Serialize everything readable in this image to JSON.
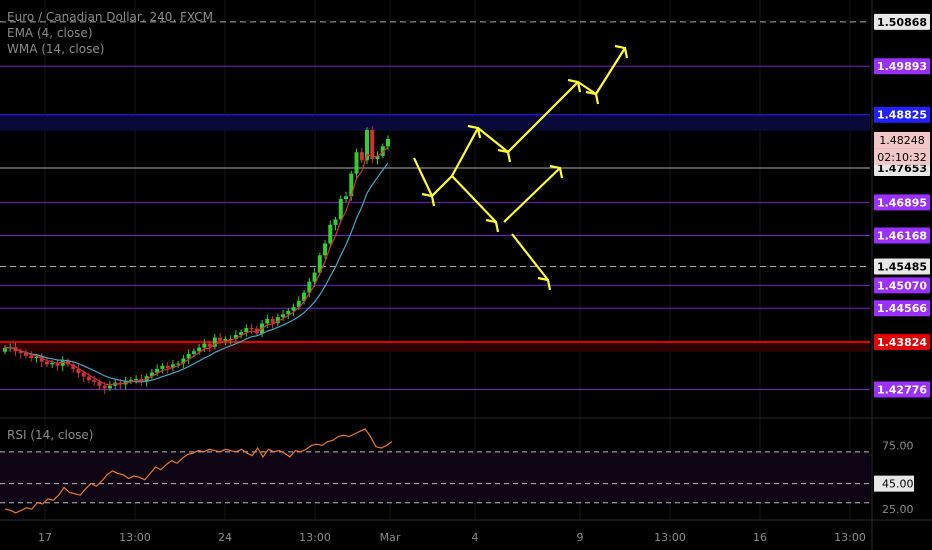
{
  "legend": {
    "title": "Euro / Canadian Dollar, 240, FXCM",
    "ema": "EMA (4, close)",
    "wma": "WMA (14, close)"
  },
  "rsi_legend": "RSI (14, close)",
  "colors": {
    "background": "#000000",
    "up_candle": "#33cc33",
    "down_candle": "#cc3333",
    "ema": "#cc3333",
    "wma": "#4aa3c8",
    "arrows": "#ffff33",
    "rsi": "#e8772e",
    "purple": "#9b30ff",
    "red": "#e00000",
    "blue": "#2222ff",
    "gray": "#aaaaaa"
  },
  "chart_data": [
    {
      "type": "candlestick",
      "title": "Euro / Canadian Dollar, 240, FXCM",
      "indicators": [
        "EMA (4, close)",
        "WMA (14, close)"
      ],
      "ylim": [
        1.4215,
        1.5135
      ],
      "x_tick_labels": [
        "17",
        "13:00",
        "24",
        "13:00",
        "Mar",
        "4",
        "9",
        "13:00",
        "16",
        "13:00"
      ],
      "price_levels": [
        {
          "value": 1.50868,
          "label": "1.50868",
          "color": "gray",
          "style": "dashed"
        },
        {
          "value": 1.49893,
          "label": "1.49893",
          "color": "purple",
          "style": "solid"
        },
        {
          "value": 1.48825,
          "label": "1.48825",
          "color": "blue",
          "style": "solid"
        },
        {
          "value": 1.47653,
          "label": "1.47653",
          "color": "gray",
          "style": "solid"
        },
        {
          "value": 1.46895,
          "label": "1.46895",
          "color": "purple",
          "style": "solid"
        },
        {
          "value": 1.46168,
          "label": "1.46168",
          "color": "purple",
          "style": "solid"
        },
        {
          "value": 1.45485,
          "label": "1.45485",
          "color": "gray",
          "style": "dashed"
        },
        {
          "value": 1.4507,
          "label": "1.45070",
          "color": "purple",
          "style": "solid"
        },
        {
          "value": 1.44566,
          "label": "1.44566",
          "color": "purple",
          "style": "solid"
        },
        {
          "value": 1.43824,
          "label": "1.43824",
          "color": "red",
          "style": "solid"
        },
        {
          "value": 1.42776,
          "label": "1.42776",
          "color": "purple",
          "style": "solid"
        }
      ],
      "current_price": "1.48248",
      "countdown": "02:10:32",
      "close": [
        1.4369,
        1.4371,
        1.4362,
        1.4358,
        1.4352,
        1.4347,
        1.435,
        1.4339,
        1.4333,
        1.4336,
        1.433,
        1.4341,
        1.4333,
        1.4323,
        1.4314,
        1.4306,
        1.4298,
        1.4294,
        1.4286,
        1.428,
        1.4286,
        1.4293,
        1.4289,
        1.4296,
        1.4299,
        1.4301,
        1.4296,
        1.4307,
        1.4315,
        1.4323,
        1.433,
        1.4325,
        1.4333,
        1.4335,
        1.4346,
        1.4356,
        1.4362,
        1.437,
        1.4379,
        1.4372,
        1.4392,
        1.4385,
        1.4389,
        1.4389,
        1.4398,
        1.4404,
        1.4413,
        1.4412,
        1.4401,
        1.4423,
        1.4433,
        1.4424,
        1.4437,
        1.4443,
        1.4451,
        1.4459,
        1.4473,
        1.4491,
        1.4515,
        1.4535,
        1.4573,
        1.4599,
        1.464,
        1.4652,
        1.4697,
        1.4703,
        1.4753,
        1.48,
        1.4782,
        1.4849,
        1.4785,
        1.4792,
        1.4813,
        1.4829
      ]
    },
    {
      "type": "line",
      "title": "RSI (14, close)",
      "ylim": [
        18,
        95
      ],
      "reference_levels": [
        70,
        45,
        30
      ],
      "y_tick_labels": [
        "75.00",
        "45.00",
        "25.00"
      ],
      "values": [
        25,
        24,
        22,
        24,
        26,
        25,
        30,
        29,
        33,
        32,
        36,
        42,
        38,
        37,
        36,
        41,
        45,
        43,
        47,
        52,
        55,
        53,
        52,
        49,
        51,
        50,
        48,
        53,
        58,
        56,
        60,
        63,
        61,
        65,
        68,
        69,
        71,
        70,
        72,
        71,
        70,
        72,
        71,
        70,
        72,
        69,
        67,
        73,
        66,
        72,
        70,
        71,
        69,
        66,
        71,
        70,
        72,
        75,
        76,
        75,
        78,
        79,
        82,
        83,
        82,
        84,
        86,
        88,
        82,
        74,
        73,
        75,
        78
      ]
    }
  ]
}
